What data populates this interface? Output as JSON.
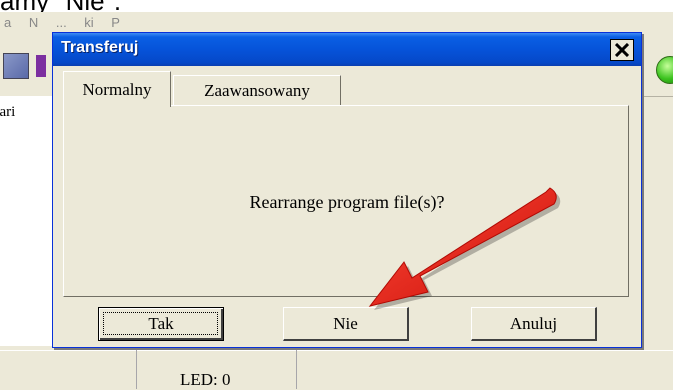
{
  "caption": {
    "text": "amy \"Nie\"."
  },
  "background_app": {
    "menubar_text": "a  N  ... ki  P",
    "left_panel_label": "nari",
    "status_led": "LED: 0"
  },
  "dialog": {
    "title": "Transferuj",
    "close_glyph": "×",
    "tabs": [
      {
        "label": "Normalny",
        "active": true
      },
      {
        "label": "Zaawansowany",
        "active": false
      }
    ],
    "message": "Rearrange program file(s)?",
    "buttons": {
      "yes": "Tak",
      "no": "Nie",
      "cancel": "Anuluj"
    }
  },
  "annotation": {
    "type": "arrow",
    "color": "#e8150f",
    "points_to": "no-button"
  },
  "icons": {
    "close": "close-icon",
    "toolbar_green": "green-circle-icon",
    "toolbar_blue": "toolbar-image-icon",
    "toolbar_purple": "toolbar-bar-icon"
  },
  "colors": {
    "title_bar": "#0653d9",
    "dialog_face": "#ece9d8",
    "arrow": "#e8150f"
  }
}
